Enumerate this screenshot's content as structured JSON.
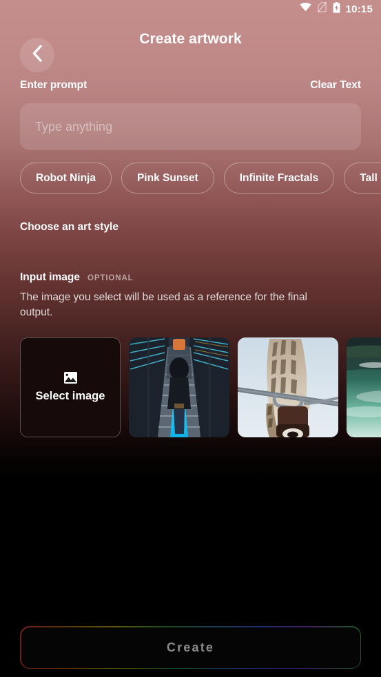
{
  "status_bar": {
    "time": "10:15",
    "icons": [
      "wifi-icon",
      "no-sim-icon",
      "battery-charging-icon"
    ]
  },
  "header": {
    "back_icon": "chevron-left-icon",
    "title": "Create artwork"
  },
  "prompt_section": {
    "label": "Enter prompt",
    "clear_action": "Clear Text",
    "input_value": "",
    "input_placeholder": "Type anything",
    "chips": [
      {
        "label": "Robot Ninja"
      },
      {
        "label": "Pink Sunset"
      },
      {
        "label": "Infinite Fractals"
      },
      {
        "label": "Tall Bird"
      }
    ]
  },
  "art_style_section": {
    "title": "Choose an art style"
  },
  "input_image_section": {
    "title": "Input image",
    "badge": "OPTIONAL",
    "description": "The image you select will be used as a reference for the final output.",
    "select_card": {
      "label": "Select image",
      "icon": "image-placeholder-icon"
    },
    "thumbnails": [
      {
        "alt": "person on escalator with blue neon lighting"
      },
      {
        "alt": "owl perched on a power line insulator"
      },
      {
        "alt": "wooden boat on a green mountain lake"
      }
    ]
  },
  "footer": {
    "create_label": "Create",
    "create_enabled": false
  },
  "colors": {
    "gradient_top": "#c48e8d",
    "gradient_mid": "#6b3030",
    "gradient_bottom": "#000000",
    "text_primary": "#ffffff",
    "create_text": "#8a8a8a"
  }
}
